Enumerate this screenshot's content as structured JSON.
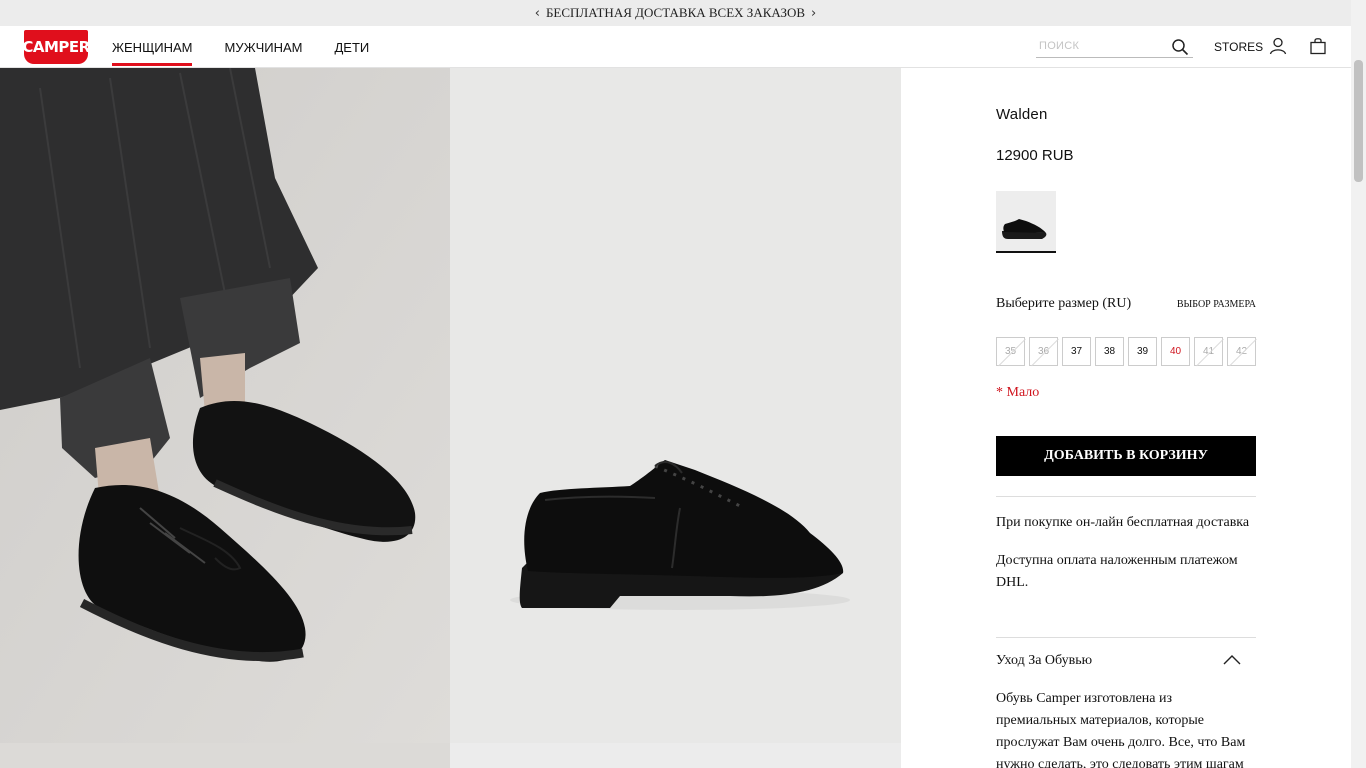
{
  "promo": {
    "text": "БЕСПЛАТНАЯ ДОСТАВКА ВСЕХ ЗАКАЗОВ",
    "prev": "‹",
    "next": "›"
  },
  "header": {
    "logo": "CAMPER",
    "nav": [
      {
        "label": "ЖЕНЩИНАМ",
        "active": true
      },
      {
        "label": "МУЖЧИНАМ",
        "active": false
      },
      {
        "label": "ДЕТИ",
        "active": false
      }
    ],
    "search_placeholder": "ПОИСК",
    "stores": "STORES"
  },
  "product": {
    "name": "Walden",
    "price": "12900 RUB",
    "size_label": "Выберите размер (RU)",
    "size_guide": "ВЫБОР РАЗМЕРА",
    "sizes": [
      {
        "value": "35",
        "state": "unavailable"
      },
      {
        "value": "36",
        "state": "unavailable"
      },
      {
        "value": "37",
        "state": "available"
      },
      {
        "value": "38",
        "state": "available"
      },
      {
        "value": "39",
        "state": "available"
      },
      {
        "value": "40",
        "state": "low"
      },
      {
        "value": "41",
        "state": "unavailable"
      },
      {
        "value": "42",
        "state": "unavailable"
      }
    ],
    "low_stock_note": "* Мало",
    "add_to_cart": "ДОБАВИТЬ В КОРЗИНУ",
    "shipping_info": "При покупке он-лайн бесплатная доставка",
    "payment_info": "Доступна оплата наложенным платежом DHL.",
    "care_title": "Уход За Обувью",
    "care_text": "Обувь Camper изготовлена из премиальных материалов, которые прослужат Вам очень долго. Все, что Вам нужно сделать, это следовать этим шагам"
  },
  "colors": {
    "accent": "#e00f1c",
    "low_stock": "#d0151f",
    "button": "#000000"
  }
}
